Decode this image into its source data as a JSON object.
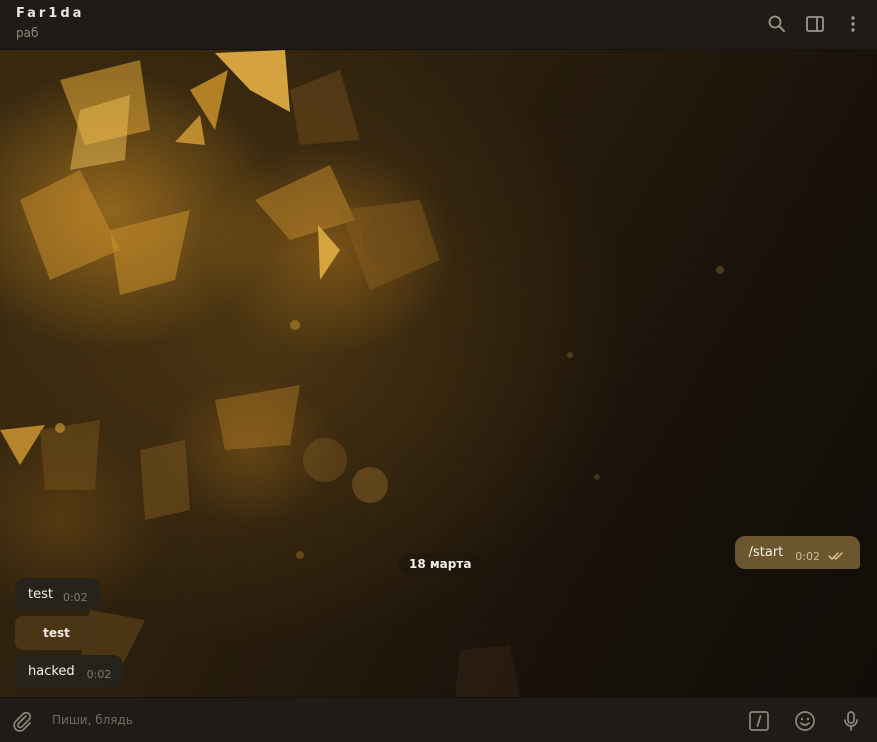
{
  "header": {
    "title": "Far1da",
    "subtitle": "раб",
    "icons": [
      "search-icon",
      "side-panel-icon",
      "more-vertical-icon"
    ]
  },
  "chat": {
    "date_separator": "18 марта",
    "messages": [
      {
        "direction": "out",
        "text": "/start",
        "time": "0:02",
        "status": "read"
      },
      {
        "direction": "in",
        "text": "test",
        "time": "0:02"
      },
      {
        "direction": "in-button",
        "text": "test"
      },
      {
        "direction": "in",
        "text": "hacked",
        "time": "0:02"
      }
    ]
  },
  "composer": {
    "placeholder": "Пиши, блядь",
    "icons": [
      "paperclip-icon",
      "bot-command-icon",
      "emoji-icon",
      "microphone-icon"
    ]
  },
  "colors": {
    "header_bg": "#1f1c18",
    "outgoing_bubble": "#6b5630",
    "incoming_bubble": "#26221c",
    "button_bubble": "#4a3516",
    "accent": "#d39a2c"
  }
}
